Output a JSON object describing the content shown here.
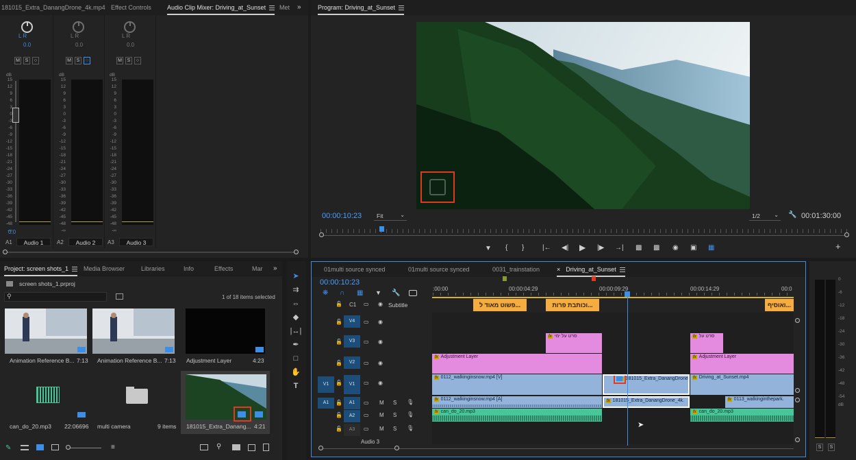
{
  "source_tabs": [
    {
      "label": "181015_Extra_DanangDrone_4k.mp4"
    },
    {
      "label": "Effect Controls"
    },
    {
      "label": "Audio Clip Mixer: Driving_at_Sunset"
    },
    {
      "label": "Met"
    }
  ],
  "audio_mixer": {
    "lr_label": "L R",
    "pan_value": "0.0",
    "db_label": "dB",
    "scale": [
      "15",
      "12",
      "9",
      "6",
      "3",
      "0",
      "-3",
      "-6",
      "-9",
      "-12",
      "-15",
      "-18",
      "-21",
      "-24",
      "-27",
      "-30",
      "-33",
      "-36",
      "-39",
      "-42",
      "-45",
      "-48",
      "-∞"
    ],
    "scale_short": [
      "15",
      "12",
      "9",
      "6",
      "3",
      "0",
      "-3",
      "-6",
      "-9",
      "-12",
      "-15",
      "-18",
      "-21",
      "-24",
      "-27",
      "-30",
      "-33",
      "-36",
      "-39",
      "-42",
      "-45",
      "-48",
      "-∞"
    ],
    "level_value": "0.0",
    "buttons": [
      "M",
      "S",
      "○"
    ],
    "channels": [
      {
        "id": "A1",
        "name": "Audio 1"
      },
      {
        "id": "A2",
        "name": "Audio 2"
      },
      {
        "id": "A3",
        "name": "Audio 3"
      }
    ]
  },
  "program": {
    "title": "Program: Driving_at_Sunset",
    "timecode": "00:00:10:23",
    "fit": "Fit",
    "resolution": "1/2",
    "duration": "00:01:30:00",
    "playhead_fraction": 0.115
  },
  "project": {
    "tabs": [
      "Project: screen shots_1",
      "Media Browser",
      "Libraries",
      "Info",
      "Effects",
      "Mar"
    ],
    "file": "screen shots_1.prproj",
    "selection": "1 of 18 items selected",
    "items": [
      {
        "name": "Animation Reference B...",
        "duration": "7:13"
      },
      {
        "name": "Animation Reference B...",
        "duration": "7:13"
      },
      {
        "name": "Adjustment Layer",
        "duration": "4:23"
      },
      {
        "name": "can_do_20.mp3",
        "duration": "22:06696"
      },
      {
        "name": "multi camera",
        "duration": "9 items"
      },
      {
        "name": "181015_Extra_Danang...",
        "duration": "4:21"
      }
    ]
  },
  "timeline": {
    "tabs": [
      "01multi source synced",
      "01multi source synced",
      "0031_trainstation",
      "Driving_at_Sunset"
    ],
    "timecode": "00:00:10:23",
    "ruler": [
      ":00:00",
      "00:00:04:29",
      "00:00:09:29",
      "00:00:14:29",
      "00:0"
    ],
    "subtitle_track": "C1",
    "subtitle_label": "Subtitle",
    "subtitles": [
      "פשוט מאוד ל...",
      "וכותבת פרות...",
      "ואוסיף..."
    ],
    "tracks": {
      "v4": "V4",
      "v3": "V3",
      "v2": "V2",
      "v1": "V1",
      "a1": "A1",
      "a2": "A2",
      "a3": "A3",
      "a3_name": "Audio 3",
      "src_v1": "V1",
      "src_a1": "A1"
    },
    "clips": {
      "v3_a": "סרט על ימי",
      "v3_b": "סרט על",
      "v2_a": "Adjustment Layer",
      "v2_b": "Adjustment Layer",
      "v1_a": "0112_walkinginsnow.mp4 [V]",
      "v1_b": "181015_Extra_DanangDrone",
      "v1_c": "Driving_at_Sunset.mp4",
      "a1_a": "0112_walkinginsnow.mp4 [A]",
      "a1_b": "181015_Extra_DanangDrone_4k.",
      "a1_c": "0113_walkinginthepark.",
      "a2_a": "can_do_20.mp3",
      "a2_b": "can_do_20.mp3"
    },
    "fx": "fx",
    "mute": "M",
    "solo": "S"
  },
  "master_meter": {
    "scale": [
      "0",
      "-6",
      "-12",
      "-18",
      "-24",
      "-30",
      "-36",
      "-42",
      "-48",
      "-54",
      "dB"
    ],
    "buttons": [
      "S",
      "S"
    ]
  },
  "colors": {
    "accent_blue": "#3d8ee6",
    "timecode_blue": "#4a9fff",
    "subtitle": "#f5ac41",
    "clip_pink": "#e48be0",
    "clip_blue": "#93b3da",
    "clip_green": "#49c59a",
    "highlight_red": "#e03a20"
  }
}
